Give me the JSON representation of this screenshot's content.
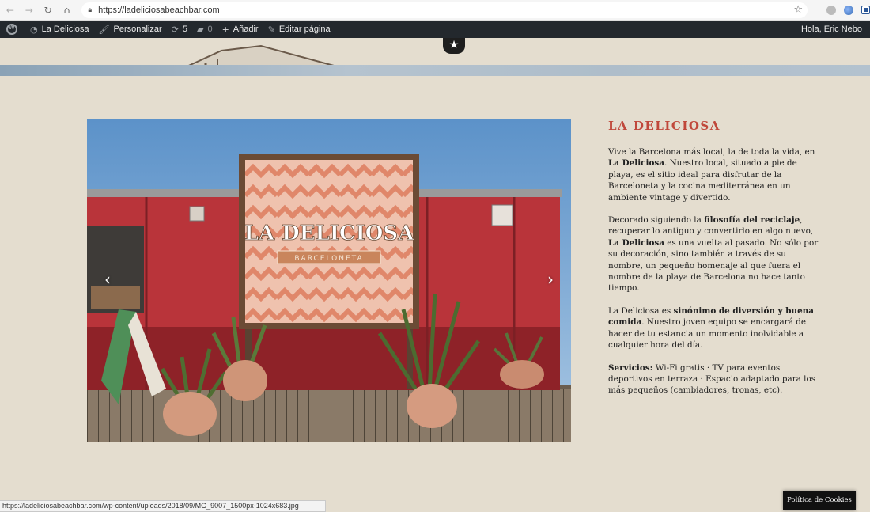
{
  "browser": {
    "url": "https://ladeliciosabeachbar.com"
  },
  "adminbar": {
    "site_name": "La Deliciosa",
    "customize": "Personalizar",
    "updates_count": "5",
    "comments_count": "0",
    "add_new": "Añadir",
    "edit_page": "Editar página",
    "greeting": "Hola, Eric Nebo"
  },
  "gallery": {
    "sign_title": "LA DELICIOSA",
    "sign_subtitle": "BARCELONETA",
    "prev_label": "‹",
    "next_label": "›"
  },
  "content": {
    "heading": "LA DELICIOSA",
    "p1": {
      "a": "Vive la Barcelona más local, la de toda la vida, en ",
      "b": "La Deliciosa",
      "c": ". Nuestro local, situado a pie de playa, es el sitio ideal para disfrutar de la Barceloneta y la cocina mediterránea en un ambiente vintage y divertido."
    },
    "p2": {
      "a": "Decorado siguiendo la ",
      "b": "filosofía del reciclaje",
      "c": ", recuperar lo antiguo y convertirlo en algo nuevo, ",
      "d": "La Deliciosa",
      "e": " es una vuelta al pasado. No sólo por su decoración, sino también a través de su nombre, un pequeño homenaje al que fuera el nombre de la playa de Barcelona no hace tanto tiempo."
    },
    "p3": {
      "a": "La Deliciosa es ",
      "b": "sinónimo de diversión y buena comida",
      "c": ". Nuestro joven equipo se encargará de hacer de tu estancia un momento inolvidable a cualquier hora del día."
    },
    "p4": {
      "a": "Servicios:",
      "b": " Wi-Fi gratis · TV para eventos deportivos en terraza · Espacio adaptado para los más pequeños (cambiadores, tronas, etc)."
    }
  },
  "status_url": "https://ladeliciosabeachbar.com/wp-content/uploads/2018/09/MG_9007_1500px-1024x683.jpg",
  "cookie_label": "Política de Cookies",
  "colors": {
    "accent": "#c0483b",
    "background": "#e4ddcf",
    "adminbar": "#23282d"
  }
}
